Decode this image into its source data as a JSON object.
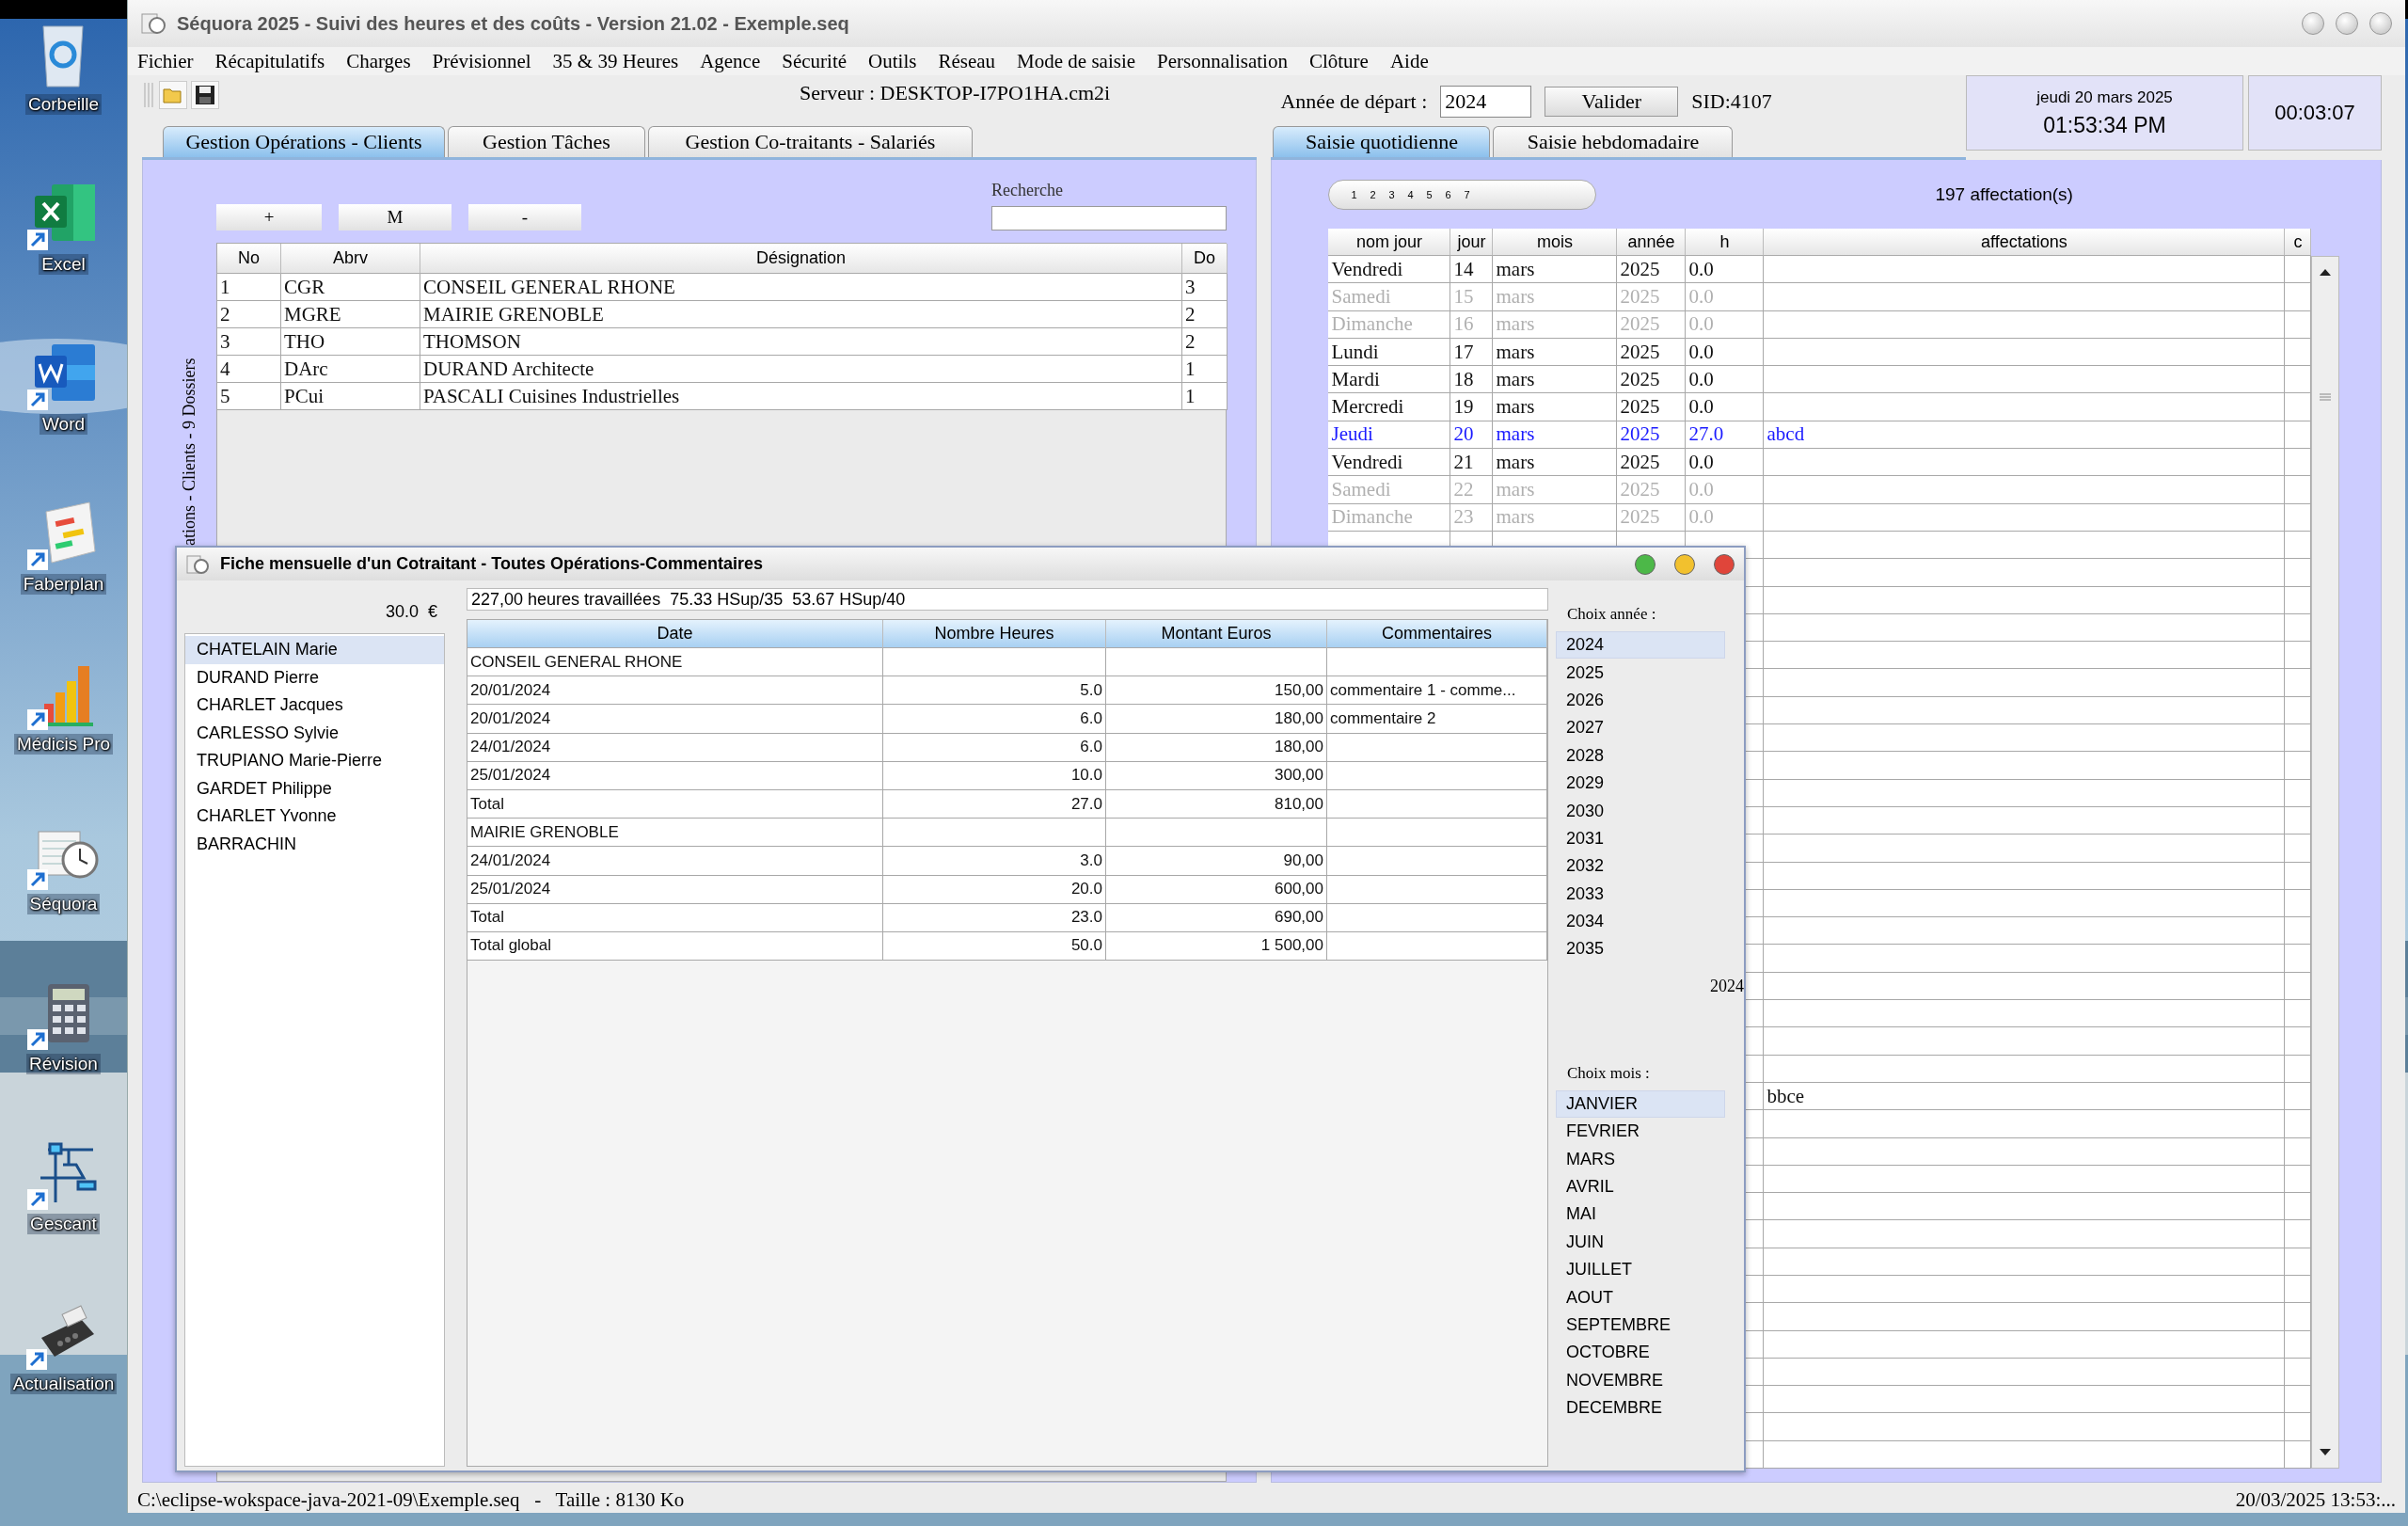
{
  "desktop_icons": [
    {
      "label": "Corbeille",
      "kind": "trash",
      "shortcut": false
    },
    {
      "label": "Excel",
      "kind": "sheet",
      "shortcut": true
    },
    {
      "label": "Word",
      "kind": "doc",
      "shortcut": true
    },
    {
      "label": "Faberplan",
      "kind": "gantt",
      "shortcut": true
    },
    {
      "label": "Médicis Pro",
      "kind": "chart",
      "shortcut": true
    },
    {
      "label": "Séquora",
      "kind": "clock",
      "shortcut": true
    },
    {
      "label": "Révision",
      "kind": "calculator",
      "shortcut": true
    },
    {
      "label": "Gescant",
      "kind": "crane",
      "shortcut": true
    },
    {
      "label": "Actualisation",
      "kind": "terminal",
      "shortcut": true
    }
  ],
  "window": {
    "title": "Séquora 2025 - Suivi des heures et des coûts - Version 21.02 - Exemple.seq"
  },
  "menu": [
    "Fichier",
    "Récapitulatifs",
    "Charges",
    "Prévisionnel",
    "35 & 39 Heures",
    "Agence",
    "Sécurité",
    "Outils",
    "Réseau",
    "Mode de saisie",
    "Personnalisation",
    "Clôture",
    "Aide"
  ],
  "server": "Serveur : DESKTOP-I7PO1HA.cm2i",
  "left_tabs": [
    {
      "label": "Gestion Opérations - Clients",
      "selected": true
    },
    {
      "label": "Gestion Tâches",
      "selected": false
    },
    {
      "label": "Gestion Co-traitants - Salariés",
      "selected": false
    }
  ],
  "start_year": {
    "label": "Année de départ :",
    "value": "2024",
    "button": "Valider"
  },
  "sid": "SID:4107",
  "clock": {
    "date": "jeudi 20 mars 2025",
    "time": "01:53:34 PM",
    "elapsed": "00:03:07"
  },
  "right_tabs": [
    {
      "label": "Saisie quotidienne",
      "selected": true
    },
    {
      "label": "Saisie hebdomadaire",
      "selected": false
    }
  ],
  "clients": {
    "buttons": [
      "+",
      "M",
      "-"
    ],
    "search_label": "Recherche",
    "side_label": "ations - Clients - 9 Dossiers",
    "columns": [
      "No",
      "Abrv",
      "Désignation",
      "Do"
    ],
    "rows": [
      [
        "1",
        "CGR",
        "CONSEIL GENERAL RHONE",
        "3"
      ],
      [
        "2",
        "MGRE",
        "MAIRIE GRENOBLE",
        "2"
      ],
      [
        "3",
        "THO",
        "THOMSON",
        "2"
      ],
      [
        "4",
        "DArc",
        "DURAND Architecte",
        "1"
      ],
      [
        "5",
        "PCui",
        "PASCALI Cuisines Industrielles",
        "1"
      ]
    ]
  },
  "daily": {
    "pages": [
      "1",
      "2",
      "3",
      "4",
      "5",
      "6",
      "7"
    ],
    "count": "197 affectation(s)",
    "columns": [
      "nom jour",
      "jour",
      "mois",
      "année",
      "h",
      "affectations",
      "c"
    ],
    "rows": [
      {
        "day_name": "Vendredi",
        "day": "14",
        "month": "mars",
        "year": "2025",
        "h": "0.0",
        "weekend": false,
        "today": false
      },
      {
        "day_name": "Samedi",
        "day": "15",
        "month": "mars",
        "year": "2025",
        "h": "0.0",
        "weekend": true,
        "today": false
      },
      {
        "day_name": "Dimanche",
        "day": "16",
        "month": "mars",
        "year": "2025",
        "h": "0.0",
        "weekend": true,
        "today": false
      },
      {
        "day_name": "Lundi",
        "day": "17",
        "month": "mars",
        "year": "2025",
        "h": "0.0",
        "weekend": false,
        "today": false
      },
      {
        "day_name": "Mardi",
        "day": "18",
        "month": "mars",
        "year": "2025",
        "h": "0.0",
        "weekend": false,
        "today": false
      },
      {
        "day_name": "Mercredi",
        "day": "19",
        "month": "mars",
        "year": "2025",
        "h": "0.0",
        "weekend": false,
        "today": false
      },
      {
        "day_name": "Jeudi",
        "day": "20",
        "month": "mars",
        "year": "2025",
        "h": "27.0",
        "affectations": "abcd",
        "weekend": false,
        "today": true
      },
      {
        "day_name": "Vendredi",
        "day": "21",
        "month": "mars",
        "year": "2025",
        "h": "0.0",
        "weekend": false,
        "today": false
      },
      {
        "day_name": "Samedi",
        "day": "22",
        "month": "mars",
        "year": "2025",
        "h": "0.0",
        "weekend": true,
        "today": false
      },
      {
        "day_name": "Dimanche",
        "day": "23",
        "month": "mars",
        "year": "2025",
        "h": "0.0",
        "weekend": true,
        "today": false
      },
      {},
      {},
      {},
      {},
      {},
      {},
      {},
      {},
      {},
      {},
      {},
      {},
      {},
      {},
      {},
      {},
      {},
      {},
      {},
      {},
      {
        "affectations": "bbce"
      }
    ]
  },
  "dialog": {
    "title": "Fiche mensuelle d'un Cotraitant - Toutes Opérations-Commentaires",
    "rate": "30.0  €",
    "workers": [
      {
        "name": "CHATELAIN Marie",
        "selected": true
      },
      {
        "name": "DURAND Pierre",
        "selected": false
      },
      {
        "name": "CHARLET Jacques",
        "selected": false
      },
      {
        "name": "CARLESSO Sylvie",
        "selected": false
      },
      {
        "name": "TRUPIANO Marie-Pierre",
        "selected": false
      },
      {
        "name": "GARDET Philippe",
        "selected": false
      },
      {
        "name": "CHARLET Yvonne",
        "selected": false
      },
      {
        "name": "BARRACHIN",
        "selected": false
      }
    ],
    "summary": "227,00 heures travaillées  75.33 HSup/35  53.67 HSup/40",
    "columns": [
      "Date",
      "Nombre Heures",
      "Montant Euros",
      "Commentaires"
    ],
    "rows": [
      {
        "date": "CONSEIL GENERAL RHONE"
      },
      {
        "date": "20/01/2024",
        "hours": "5.0",
        "amount": "150,00",
        "comment": "commentaire 1 - comme..."
      },
      {
        "date": "20/01/2024",
        "hours": "6.0",
        "amount": "180,00",
        "comment": "commentaire 2"
      },
      {
        "date": "24/01/2024",
        "hours": "6.0",
        "amount": "180,00"
      },
      {
        "date": "25/01/2024",
        "hours": "10.0",
        "amount": "300,00"
      },
      {
        "date": "Total",
        "hours": "27.0",
        "amount": "810,00"
      },
      {
        "date": "MAIRIE GRENOBLE"
      },
      {
        "date": "24/01/2024",
        "hours": "3.0",
        "amount": "90,00"
      },
      {
        "date": "25/01/2024",
        "hours": "20.0",
        "amount": "600,00"
      },
      {
        "date": "Total",
        "hours": "23.0",
        "amount": "690,00"
      },
      {
        "date": "Total global",
        "hours": "50.0",
        "amount": "1 500,00"
      }
    ],
    "year_label": "Choix année :",
    "years": [
      {
        "label": "2024",
        "selected": true
      },
      {
        "label": "2025",
        "selected": false
      },
      {
        "label": "2026",
        "selected": false
      },
      {
        "label": "2027",
        "selected": false
      },
      {
        "label": "2028",
        "selected": false
      },
      {
        "label": "2029",
        "selected": false
      },
      {
        "label": "2030",
        "selected": false
      },
      {
        "label": "2031",
        "selected": false
      },
      {
        "label": "2032",
        "selected": false
      },
      {
        "label": "2033",
        "selected": false
      },
      {
        "label": "2034",
        "selected": false
      },
      {
        "label": "2035",
        "selected": false
      }
    ],
    "chosen_year": "2024",
    "month_label": "Choix mois :",
    "months": [
      {
        "label": "JANVIER",
        "selected": true
      },
      {
        "label": "FEVRIER",
        "selected": false
      },
      {
        "label": "MARS",
        "selected": false
      },
      {
        "label": "AVRIL",
        "selected": false
      },
      {
        "label": "MAI",
        "selected": false
      },
      {
        "label": "JUIN",
        "selected": false
      },
      {
        "label": "JUILLET",
        "selected": false
      },
      {
        "label": "AOUT",
        "selected": false
      },
      {
        "label": "SEPTEMBRE",
        "selected": false
      },
      {
        "label": "OCTOBRE",
        "selected": false
      },
      {
        "label": "NOVEMBRE",
        "selected": false
      },
      {
        "label": "DECEMBRE",
        "selected": false
      }
    ]
  },
  "status": {
    "file": "C:\\eclipse-wokspace-java-2021-09\\Exemple.seq   -   Taille : 8130 Ko",
    "datetime": "20/03/2025 13:53:..."
  }
}
